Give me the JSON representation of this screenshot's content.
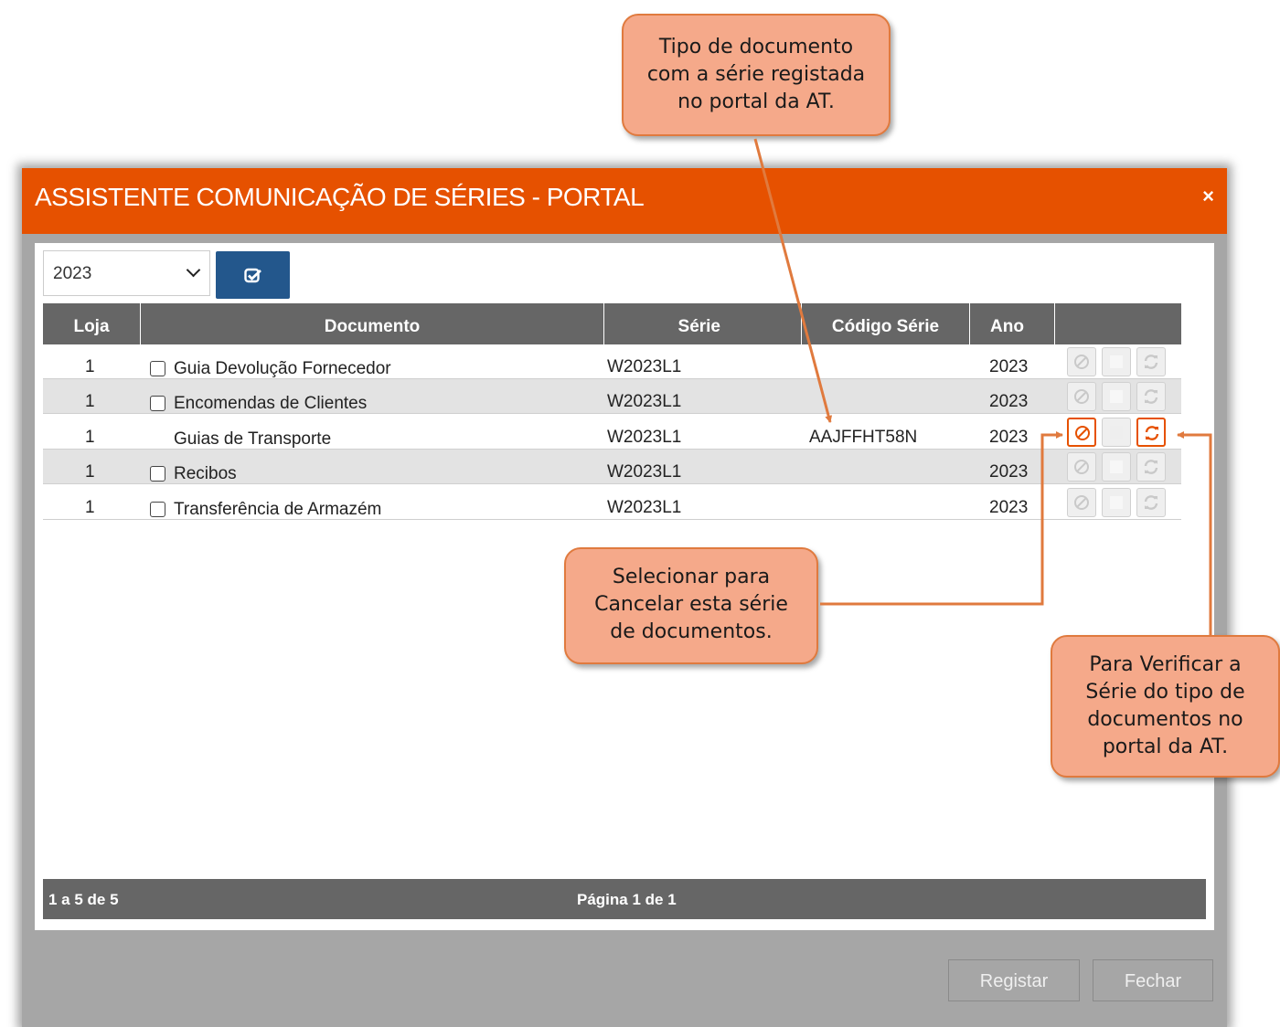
{
  "dialog": {
    "title": "ASSISTENTE COMUNICAÇÃO DE SÉRIES - PORTAL",
    "close_label": "×"
  },
  "filter": {
    "year": "2023",
    "apply_icon": "check-square-icon"
  },
  "grid": {
    "columns": [
      "Loja",
      "Documento",
      "Série",
      "Código Série",
      "Ano",
      ""
    ],
    "rows": [
      {
        "loja": "1",
        "documento": "Guia Devolução Fornecedor",
        "serie": "W2023L1",
        "codigo": "",
        "ano": "2023",
        "checkbox": true
      },
      {
        "loja": "1",
        "documento": "Encomendas de Clientes",
        "serie": "W2023L1",
        "codigo": "",
        "ano": "2023",
        "checkbox": true
      },
      {
        "loja": "1",
        "documento": "Guias de Transporte",
        "serie": "W2023L1",
        "codigo": "AAJFFHT58N",
        "ano": "2023",
        "checkbox": false
      },
      {
        "loja": "1",
        "documento": "Recibos",
        "serie": "W2023L1",
        "codigo": "",
        "ano": "2023",
        "checkbox": true
      },
      {
        "loja": "1",
        "documento": "Transferência de Armazém",
        "serie": "W2023L1",
        "codigo": "",
        "ano": "2023",
        "checkbox": true
      }
    ],
    "action_icons": [
      "cancel-icon",
      "stop-icon",
      "refresh-icon"
    ]
  },
  "pager": {
    "range": "1 a 5 de 5",
    "page": "Página 1 de 1"
  },
  "buttons": {
    "register": "Registar",
    "close": "Fechar"
  },
  "callouts": {
    "top": [
      "Tipo de documento",
      "com a série registada",
      "no portal da AT."
    ],
    "middle": [
      "Selecionar para",
      "Cancelar esta série",
      "de documentos."
    ],
    "right": [
      "Para Verificar a",
      "Série do tipo de",
      "documentos no",
      "portal da AT."
    ]
  },
  "colors": {
    "titlebar": "#e65100",
    "grid_header": "#666666",
    "apply_button": "#23578c",
    "callout_fill": "#f5a98a",
    "callout_border": "#e07a3e"
  }
}
